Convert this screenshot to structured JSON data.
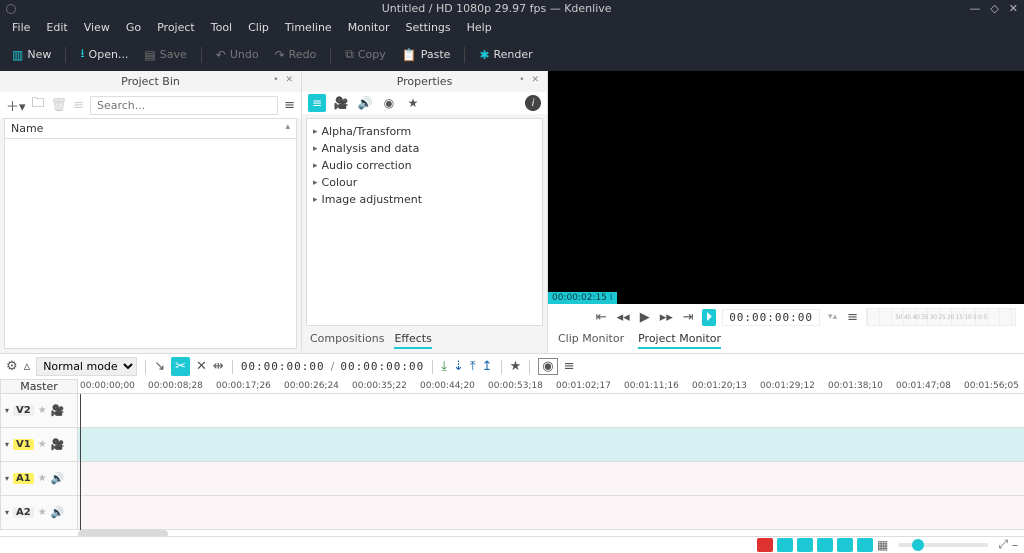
{
  "window": {
    "title": "Untitled / HD 1080p 29.97 fps — Kdenlive"
  },
  "menu": [
    "File",
    "Edit",
    "View",
    "Go",
    "Project",
    "Tool",
    "Clip",
    "Timeline",
    "Monitor",
    "Settings",
    "Help"
  ],
  "toolbar": {
    "new": "New",
    "open": "Open...",
    "save": "Save",
    "undo": "Undo",
    "redo": "Redo",
    "copy": "Copy",
    "paste": "Paste",
    "render": "Render"
  },
  "bin": {
    "title": "Project Bin",
    "search_placeholder": "Search...",
    "column_name": "Name"
  },
  "props": {
    "title": "Properties",
    "categories": [
      "Alpha/Transform",
      "Analysis and data",
      "Audio correction",
      "Colour",
      "Image adjustment"
    ],
    "tabs": {
      "compositions": "Compositions",
      "effects": "Effects"
    }
  },
  "monitor": {
    "tc_badge": "00:00:02:15 ⁞",
    "timecode": "00:00:00:00",
    "tabs": {
      "clip": "Clip Monitor",
      "project": "Project Monitor"
    }
  },
  "tl_toolbar": {
    "mode": "Normal mode",
    "tc_current": "00:00:00:00",
    "tc_total": "00:00:00:00"
  },
  "timeline": {
    "master": "Master",
    "ruler": [
      "00:00:00;00",
      "00:00:08;28",
      "00:00:17;26",
      "00:00:26;24",
      "00:00:35;22",
      "00:00:44;20",
      "00:00:53;18",
      "00:01:02;17",
      "00:01:11;16",
      "00:01:20;13",
      "00:01:29;12",
      "00:01:38;10",
      "00:01:47;08",
      "00:01:56;05"
    ],
    "tracks": {
      "v2": "V2",
      "v1": "V1",
      "a1": "A1",
      "a2": "A2"
    }
  }
}
